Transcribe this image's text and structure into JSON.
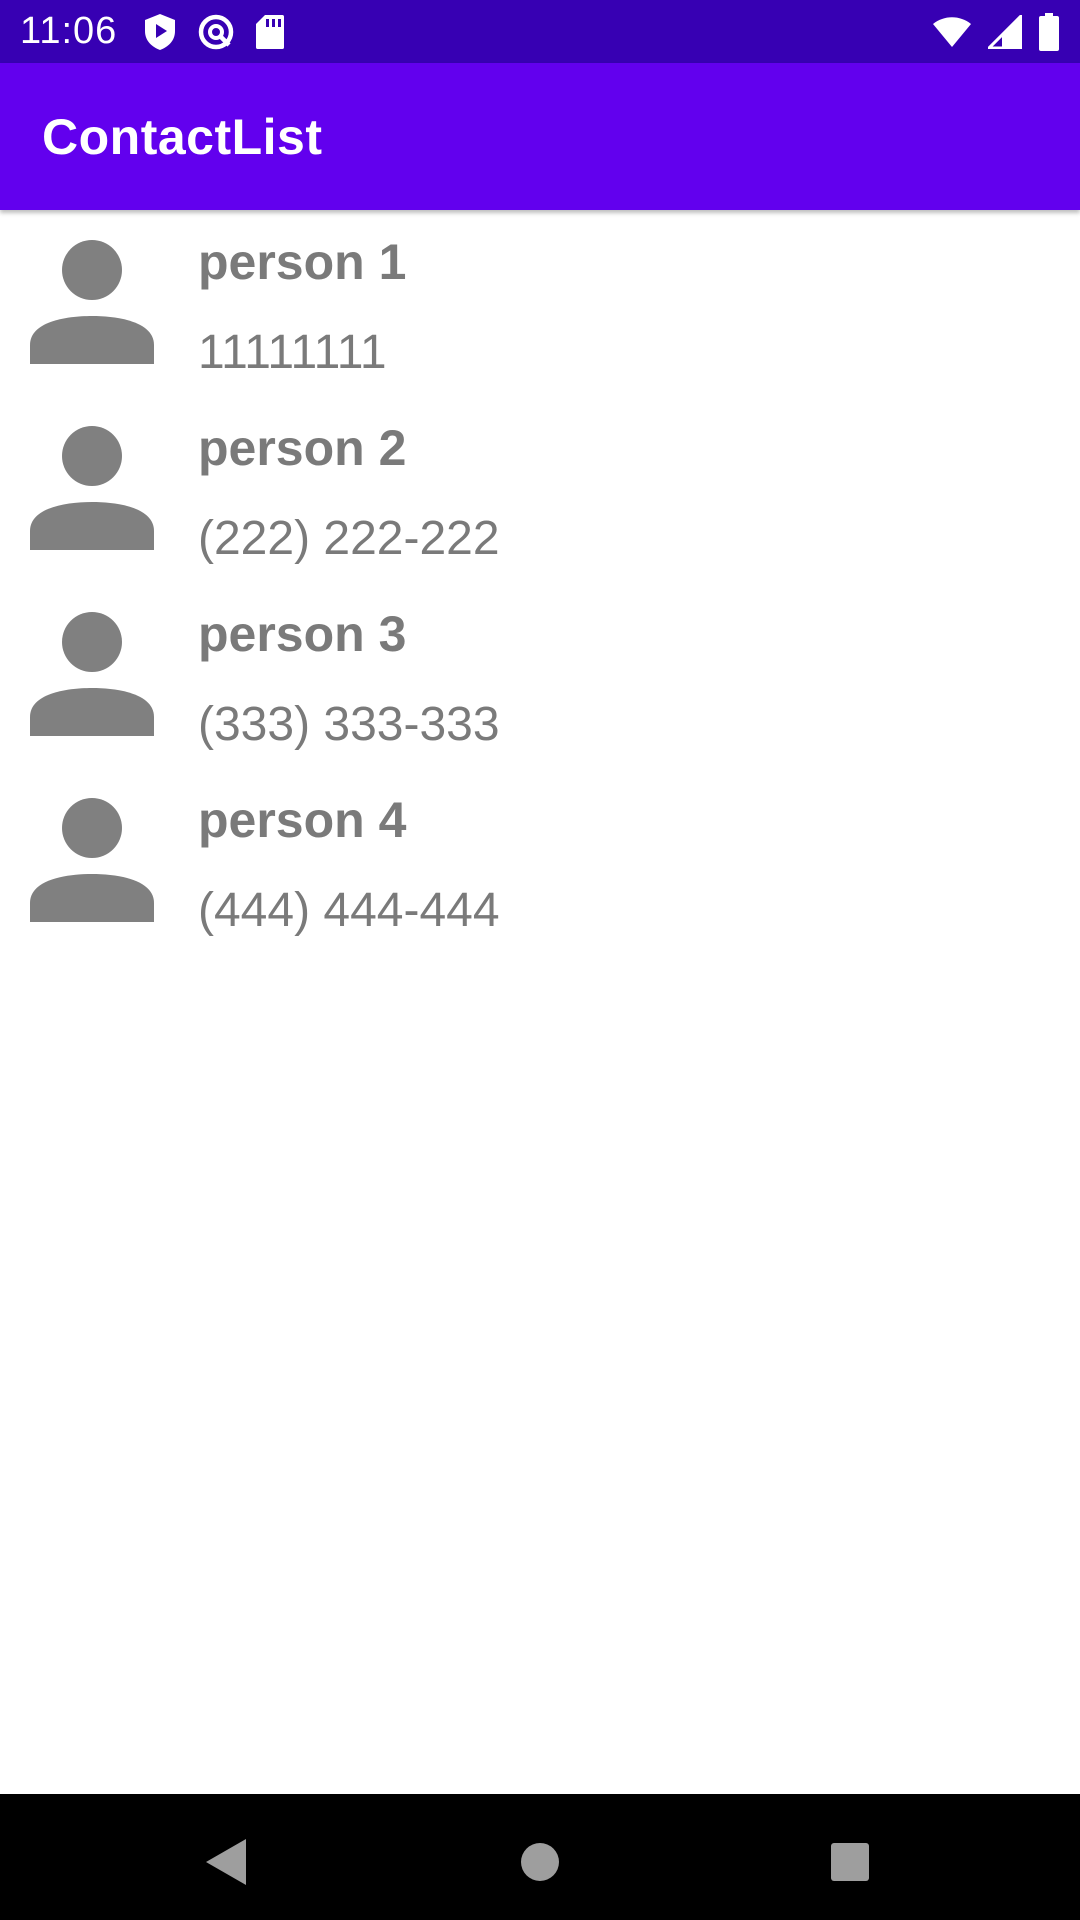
{
  "status_bar": {
    "time": "11:06",
    "left_icons": [
      "play-shield-icon",
      "sync-icon",
      "sd-card-icon"
    ],
    "right_icons": [
      "wifi-icon",
      "cell-signal-icon",
      "battery-icon"
    ]
  },
  "app_bar": {
    "title": "ContactList"
  },
  "contacts": [
    {
      "name": "person 1",
      "phone": "11111111"
    },
    {
      "name": "person 2",
      "phone": "(222) 222-222"
    },
    {
      "name": "person 3",
      "phone": "(333) 333-333"
    },
    {
      "name": "person 4",
      "phone": "(444) 444-444"
    }
  ],
  "nav_bar": {
    "buttons": [
      "back-icon",
      "home-icon",
      "recents-icon"
    ]
  },
  "colors": {
    "status_bar": "#3700b3",
    "app_bar": "#6200ee",
    "contact_text": "#7a7a7a",
    "avatar": "#808080",
    "nav_bar": "#000000"
  }
}
